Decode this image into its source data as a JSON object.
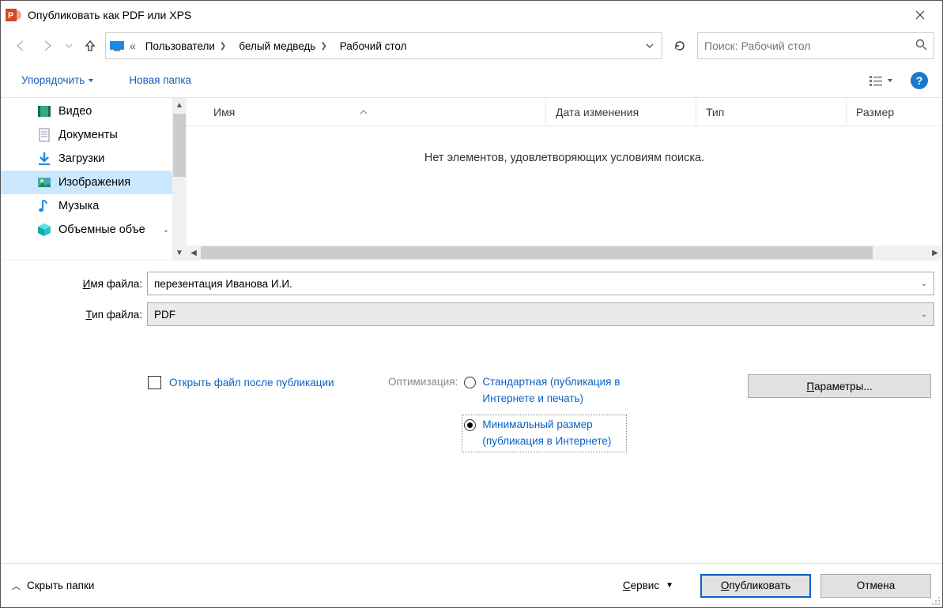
{
  "window": {
    "title": "Опубликовать как PDF или XPS"
  },
  "breadcrumb": {
    "ellipsis": "«",
    "segments": [
      "Пользователи",
      "белый медведь",
      "Рабочий стол"
    ]
  },
  "search": {
    "placeholder": "Поиск: Рабочий стол"
  },
  "toolbar": {
    "organize": "Упорядочить",
    "new_folder": "Новая папка",
    "help_char": "?"
  },
  "sidebar": {
    "items": [
      {
        "label": "Видео",
        "icon": "video"
      },
      {
        "label": "Документы",
        "icon": "doc"
      },
      {
        "label": "Загрузки",
        "icon": "download"
      },
      {
        "label": "Изображения",
        "icon": "image",
        "selected": true
      },
      {
        "label": "Музыка",
        "icon": "music"
      },
      {
        "label": "Объемные объе",
        "icon": "cube"
      }
    ]
  },
  "columns": {
    "name": "Имя",
    "date": "Дата изменения",
    "type": "Тип",
    "size": "Размер"
  },
  "empty_message": "Нет элементов, удовлетворяющих условиям поиска.",
  "filename_label_pre": "И",
  "filename_label_post": "мя файла:",
  "filename_value": "перезентация Иванова И.И.",
  "filetype_label_pre": "Т",
  "filetype_label_post": "ип файла:",
  "filetype_value": "PDF",
  "open_after_label": "Открыть файл после публикации",
  "optimization_label": "Оптимизация:",
  "radio_standard": "Стандартная (публикация в Интернете и печать)",
  "radio_minimal": "Минимальный размер (публикация в Интернете)",
  "params_label_pre": "П",
  "params_label_post": "араметры...",
  "footer": {
    "hide_folders": "Скрыть папки",
    "tools_pre": "С",
    "tools_post": "ервис",
    "publish_pre": "О",
    "publish_post": "публиковать",
    "cancel": "Отмена"
  }
}
